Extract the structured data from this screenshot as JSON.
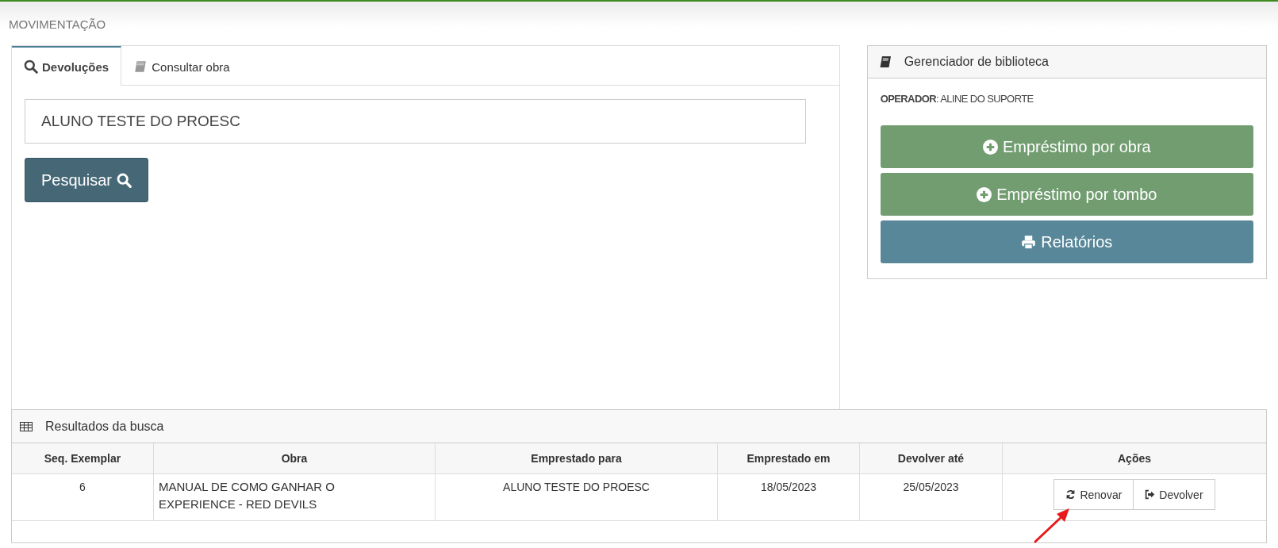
{
  "page_title": "MOVIMENTAÇÃO",
  "tabs": [
    {
      "label": "Devoluções",
      "kind": "search",
      "selected": true
    },
    {
      "label": "Consultar obra",
      "kind": "book",
      "selected": false
    }
  ],
  "search": {
    "value": "ALUNO TESTE DO PROESC",
    "button": "Pesquisar"
  },
  "library_panel": {
    "title": "Gerenciador de biblioteca",
    "operator": "**OPERADOR**: ALINE DO SUPORTE",
    "buttons": [
      {
        "label": "Empréstimo por obra",
        "kind": "add"
      },
      {
        "label": "Empréstimo por tombo",
        "kind": "add"
      },
      {
        "label": "Relatórios",
        "kind": "print"
      }
    ]
  },
  "results": {
    "title": "Resultados da busca",
    "columns": [
      "Seq. Exemplar",
      "Obra",
      "Emprestado para",
      "Emprestado em",
      "Devolver até",
      "Ações"
    ],
    "rows": [
      {
        "cells": [
          "6",
          "MANUAL DE COMO GANHAR O EXPERIENCE - RED DEVILS",
          "ALUNO TESTE DO PROESC",
          "18/05/2023",
          "25/05/2023"
        ],
        "actions": [
          {
            "label": "Renovar",
            "kind": "renew"
          },
          {
            "label": "Devolver",
            "kind": "return"
          }
        ]
      }
    ]
  }
}
